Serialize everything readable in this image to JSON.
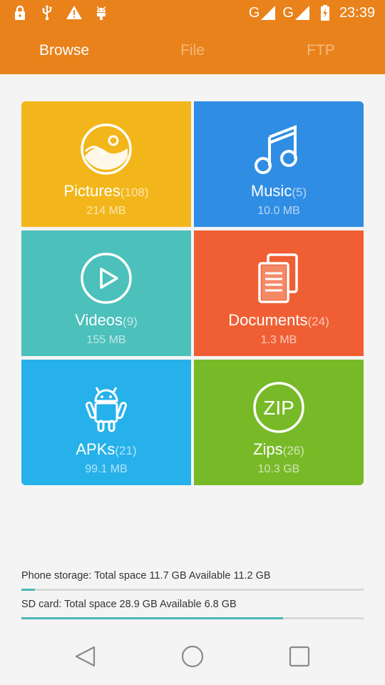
{
  "status_bar": {
    "left_icons": [
      "lock-icon",
      "usb-icon",
      "warning-icon",
      "android-debug-icon"
    ],
    "network_1": "G",
    "network_2": "G",
    "time": "23:39"
  },
  "tabs": [
    {
      "label": "Browse",
      "active": true
    },
    {
      "label": "File",
      "active": false
    },
    {
      "label": "FTP",
      "active": false
    }
  ],
  "categories": [
    {
      "name": "Pictures",
      "count": "(108)",
      "size": "214 MB",
      "color": "#f3b61a",
      "icon": "picture-icon"
    },
    {
      "name": "Music",
      "count": "(5)",
      "size": "10.0 MB",
      "color": "#2f8de4",
      "icon": "music-note-icon"
    },
    {
      "name": "Videos",
      "count": "(9)",
      "size": "155 MB",
      "color": "#4cc0bb",
      "icon": "play-icon"
    },
    {
      "name": "Documents",
      "count": "(24)",
      "size": "1.3 MB",
      "color": "#f05f34",
      "icon": "documents-icon"
    },
    {
      "name": "APKs",
      "count": "(21)",
      "size": "99.1 MB",
      "color": "#27b1ea",
      "icon": "android-icon"
    },
    {
      "name": "Zips",
      "count": "(26)",
      "size": "10.3 GB",
      "color": "#78b928",
      "icon": "zip-icon",
      "icon_text": "ZIP"
    }
  ],
  "storage": [
    {
      "label": "Phone storage: Total space 11.7 GB  Available 11.2 GB",
      "used_fraction": 0.04
    },
    {
      "label": "SD card: Total space 28.9 GB  Available 6.8 GB",
      "used_fraction": 0.765
    }
  ],
  "nav": [
    "back-icon",
    "home-icon",
    "recents-icon"
  ],
  "colors": {
    "appbar": "#e9821a",
    "progress": "#4cb8b4"
  }
}
